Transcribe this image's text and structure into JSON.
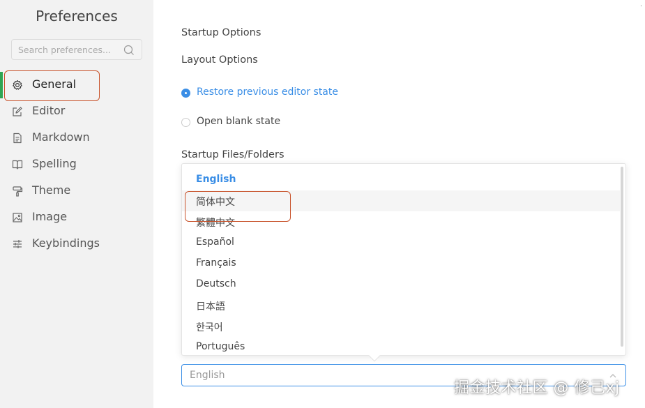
{
  "sidebar": {
    "title": "Preferences",
    "search": {
      "placeholder": "Search preferences..."
    },
    "items": [
      {
        "label": "General",
        "icon": "gear-icon",
        "active": true
      },
      {
        "label": "Editor",
        "icon": "edit-icon"
      },
      {
        "label": "Markdown",
        "icon": "document-icon"
      },
      {
        "label": "Spelling",
        "icon": "book-icon"
      },
      {
        "label": "Theme",
        "icon": "paint-roller-icon"
      },
      {
        "label": "Image",
        "icon": "image-icon"
      },
      {
        "label": "Keybindings",
        "icon": "sliders-icon"
      }
    ]
  },
  "main": {
    "corner_mark": "·",
    "startup_options": "Startup Options",
    "layout_options": "Layout Options",
    "radio_restore": "Restore previous editor state",
    "radio_blank": "Open blank state",
    "startup_files": "Startup Files/Folders",
    "language_options": [
      {
        "label": "English",
        "selected": true
      },
      {
        "label": "简体中文",
        "hovered": true
      },
      {
        "label": "繁體中文"
      },
      {
        "label": "Español"
      },
      {
        "label": "Français"
      },
      {
        "label": "Deutsch"
      },
      {
        "label": "日本語"
      },
      {
        "label": "한국어"
      },
      {
        "label": "Português"
      }
    ],
    "language_value": "English"
  },
  "watermark": "掘金技术社区 @ 修己xj",
  "colors": {
    "accent": "#3a8ee6",
    "active_bar": "#2fa553",
    "annotation": "#c8522a",
    "sidebar_bg": "#f2f2f2"
  }
}
